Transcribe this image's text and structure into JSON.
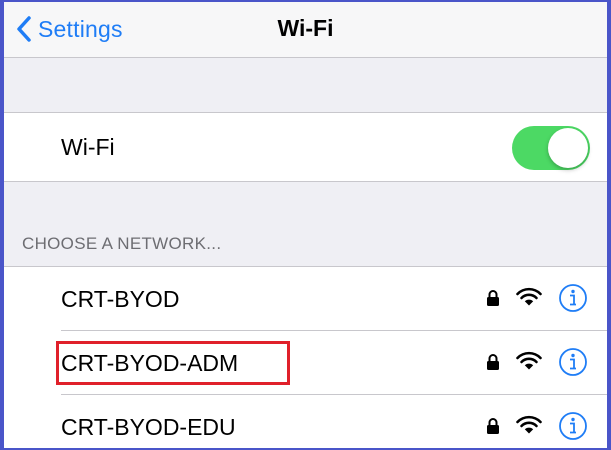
{
  "navbar": {
    "back_label": "Settings",
    "title": "Wi-Fi"
  },
  "wifi": {
    "label": "Wi-Fi",
    "enabled": true
  },
  "section": {
    "header": "CHOOSE A NETWORK..."
  },
  "networks": [
    {
      "name": "CRT-BYOD",
      "secured": true,
      "highlighted": false
    },
    {
      "name": "CRT-BYOD-ADM",
      "secured": true,
      "highlighted": true
    },
    {
      "name": "CRT-BYOD-EDU",
      "secured": true,
      "highlighted": false
    }
  ],
  "colors": {
    "accent": "#1f7df6",
    "toggle_on": "#4cd964",
    "highlight": "#e0202a",
    "frame": "#4a55c9"
  },
  "icons": {
    "back": "chevron-left-icon",
    "lock": "lock-icon",
    "signal": "wifi-signal-icon",
    "info": "info-icon"
  }
}
